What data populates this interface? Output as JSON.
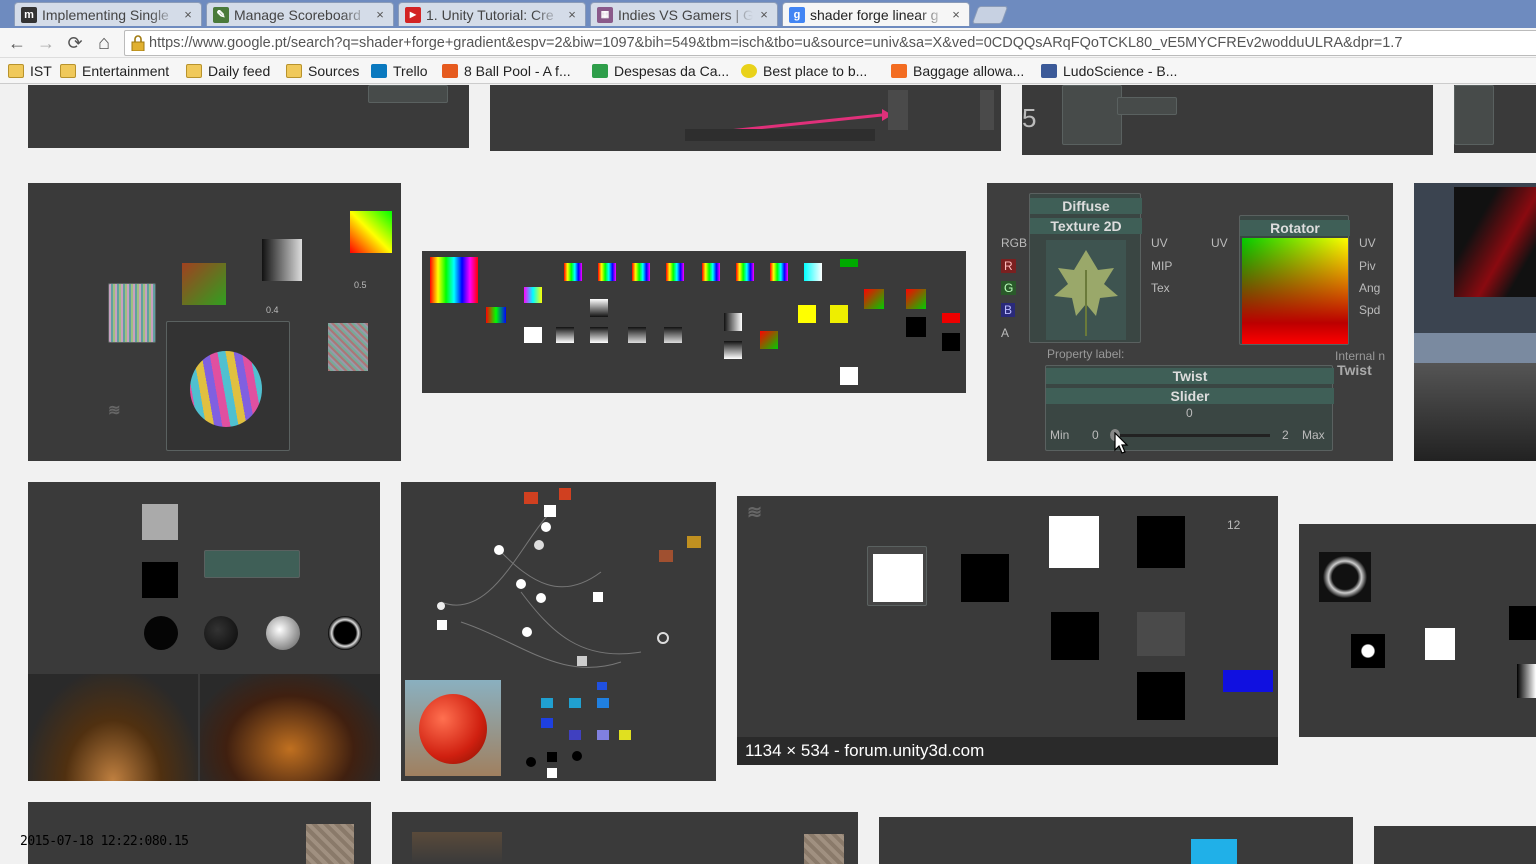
{
  "tabs": [
    {
      "title": "Implementing Single",
      "icon": "m-logo-icon",
      "color": "#333333",
      "active": false
    },
    {
      "title": "Manage Scoreboard",
      "icon": "pencil-doc-icon",
      "color": "#4a7a3a",
      "active": false
    },
    {
      "title": "1. Unity Tutorial: Cre",
      "icon": "youtube-icon",
      "color": "#d32323",
      "active": false
    },
    {
      "title": "Indies VS Gamers | G",
      "icon": "gamepad-icon",
      "color": "#8a5a8a",
      "active": false
    },
    {
      "title": "shader forge linear g",
      "icon": "google-icon",
      "color": "#4285f4",
      "active": true
    }
  ],
  "close_glyph": "×",
  "toolbar": {
    "back": "←",
    "forward": "→",
    "reload": "⟳",
    "home": "⌂",
    "url": "https://www.google.pt/search?q=shader+forge+gradient&espv=2&biw=1097&bih=549&tbm=isch&tbo=u&source=univ&sa=X&ved=0CDQQsARqFQoTCKL80_vE5MYCFREv2wodduULRA&dpr=1.7"
  },
  "bookmarks": [
    {
      "label": "IST",
      "icon": "folder-icon"
    },
    {
      "label": "Entertainment",
      "icon": "folder-icon"
    },
    {
      "label": "Daily feed",
      "icon": "folder-icon"
    },
    {
      "label": "Sources",
      "icon": "folder-icon"
    },
    {
      "label": "Trello",
      "icon": "trello-icon"
    },
    {
      "label": "8 Ball Pool - A f...",
      "icon": "play-icon"
    },
    {
      "label": "Despesas da Ca...",
      "icon": "sheets-icon"
    },
    {
      "label": "Best place to b...",
      "icon": "smiley-icon"
    },
    {
      "label": "Baggage allowa...",
      "icon": "e-logo-icon"
    },
    {
      "label": "LudoScience - B...",
      "icon": "facebook-icon"
    }
  ],
  "results": {
    "hover_caption": "1134 × 534 - forum.unity3d.com",
    "preview_node": {
      "diffuse": "Diffuse",
      "texture2d": "Texture 2D",
      "rotator": "Rotator",
      "property_label": "Property label:",
      "internal_name": "Internal n",
      "twist": "Twist",
      "twist_internal": "Twist",
      "slider": "Slider",
      "slider_value": "0",
      "min_label": "Min",
      "min_value": "0",
      "max_label": "Max",
      "max_value": "2",
      "ports_left": [
        "RGB",
        "R",
        "G",
        "B",
        "A"
      ],
      "ports_mid": [
        "UV",
        "MIP",
        "Tex"
      ],
      "uv": "UV",
      "ports_right": [
        "UV",
        "Piv",
        "Ang",
        "Spd"
      ]
    },
    "forum_value": "12",
    "tiny_labels": {
      "value_05": "0.5",
      "value_04": "0.4",
      "fragment_5": "5"
    }
  },
  "timestamp": "2015-07-18 12:22:080.15",
  "colors": {
    "tabstrip": "#6e8bbf",
    "node_header": "#3f5f57",
    "image_bg": "#3a3a3a"
  }
}
